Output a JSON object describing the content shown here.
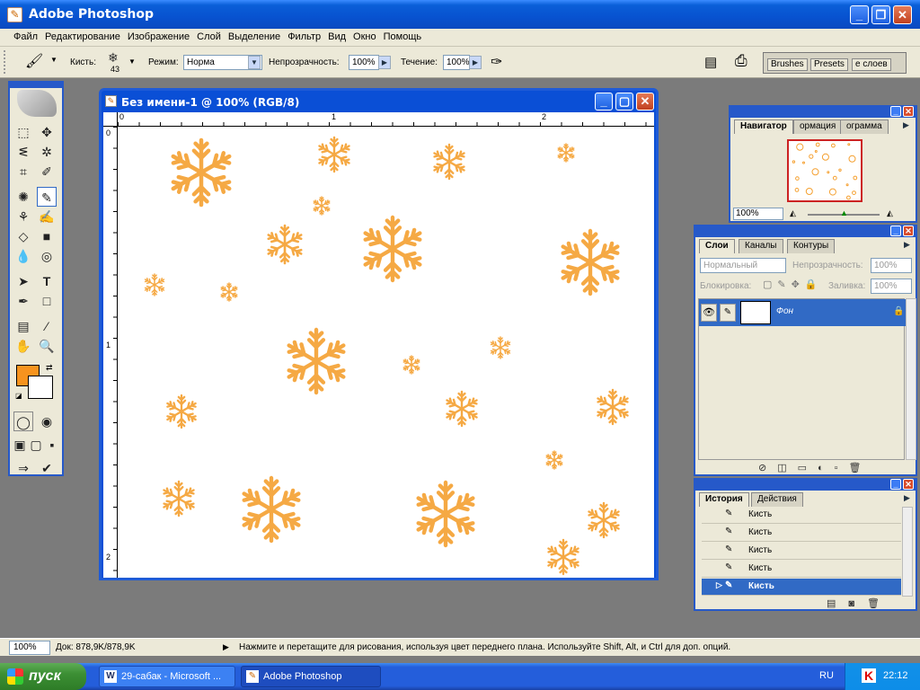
{
  "app": {
    "title": "Adobe Photoshop"
  },
  "menu": [
    "Файл",
    "Редактирование",
    "Изображение",
    "Слой",
    "Выделение",
    "Фильтр",
    "Вид",
    "Окно",
    "Помощь"
  ],
  "options": {
    "brush_label": "Кисть:",
    "brush_size": "43",
    "mode_label": "Режим:",
    "mode_value": "Норма",
    "opacity_label": "Непрозрачность:",
    "opacity_value": "100%",
    "flow_label": "Течение:",
    "flow_value": "100%",
    "tabs": [
      "Brushes",
      "Presets",
      "е слоев"
    ]
  },
  "document": {
    "title": "Без имени-1 @ 100% (RGB/8)",
    "ruler_h": [
      "0",
      "1",
      "2"
    ],
    "ruler_v": [
      "0",
      "1",
      "2"
    ],
    "flake_color": "#f5a030"
  },
  "navigator": {
    "tabs": [
      "Навигатор",
      "ормация",
      "ограмма"
    ],
    "zoom": "100%"
  },
  "layers": {
    "tabs": [
      "Слои",
      "Каналы",
      "Контуры"
    ],
    "blend_mode": "Нормальный",
    "opacity_label": "Непрозрачность:",
    "opacity_value": "100%",
    "lock_label": "Блокировка:",
    "fill_label": "Заливка:",
    "fill_value": "100%",
    "layer_name": "Фон"
  },
  "history": {
    "tabs": [
      "История",
      "Действия"
    ],
    "items": [
      "Кисть",
      "Кисть",
      "Кисть",
      "Кисть",
      "Кисть"
    ]
  },
  "status": {
    "zoom": "100%",
    "doc": "Док: 878,9K/878,9K",
    "hint": "Нажмите и перетащите для рисования, используя цвет переднего плана. Используйте Shift, Alt, и Ctrl для доп. опций."
  },
  "taskbar": {
    "start": "пуск",
    "tasks": [
      "29-сабак - Microsoft ...",
      "Adobe Photoshop"
    ],
    "lang": "RU",
    "clock": "22:12"
  },
  "colors": {
    "foreground": "#f7931e",
    "background": "#ffffff",
    "xp_blue": "#2659c9"
  }
}
